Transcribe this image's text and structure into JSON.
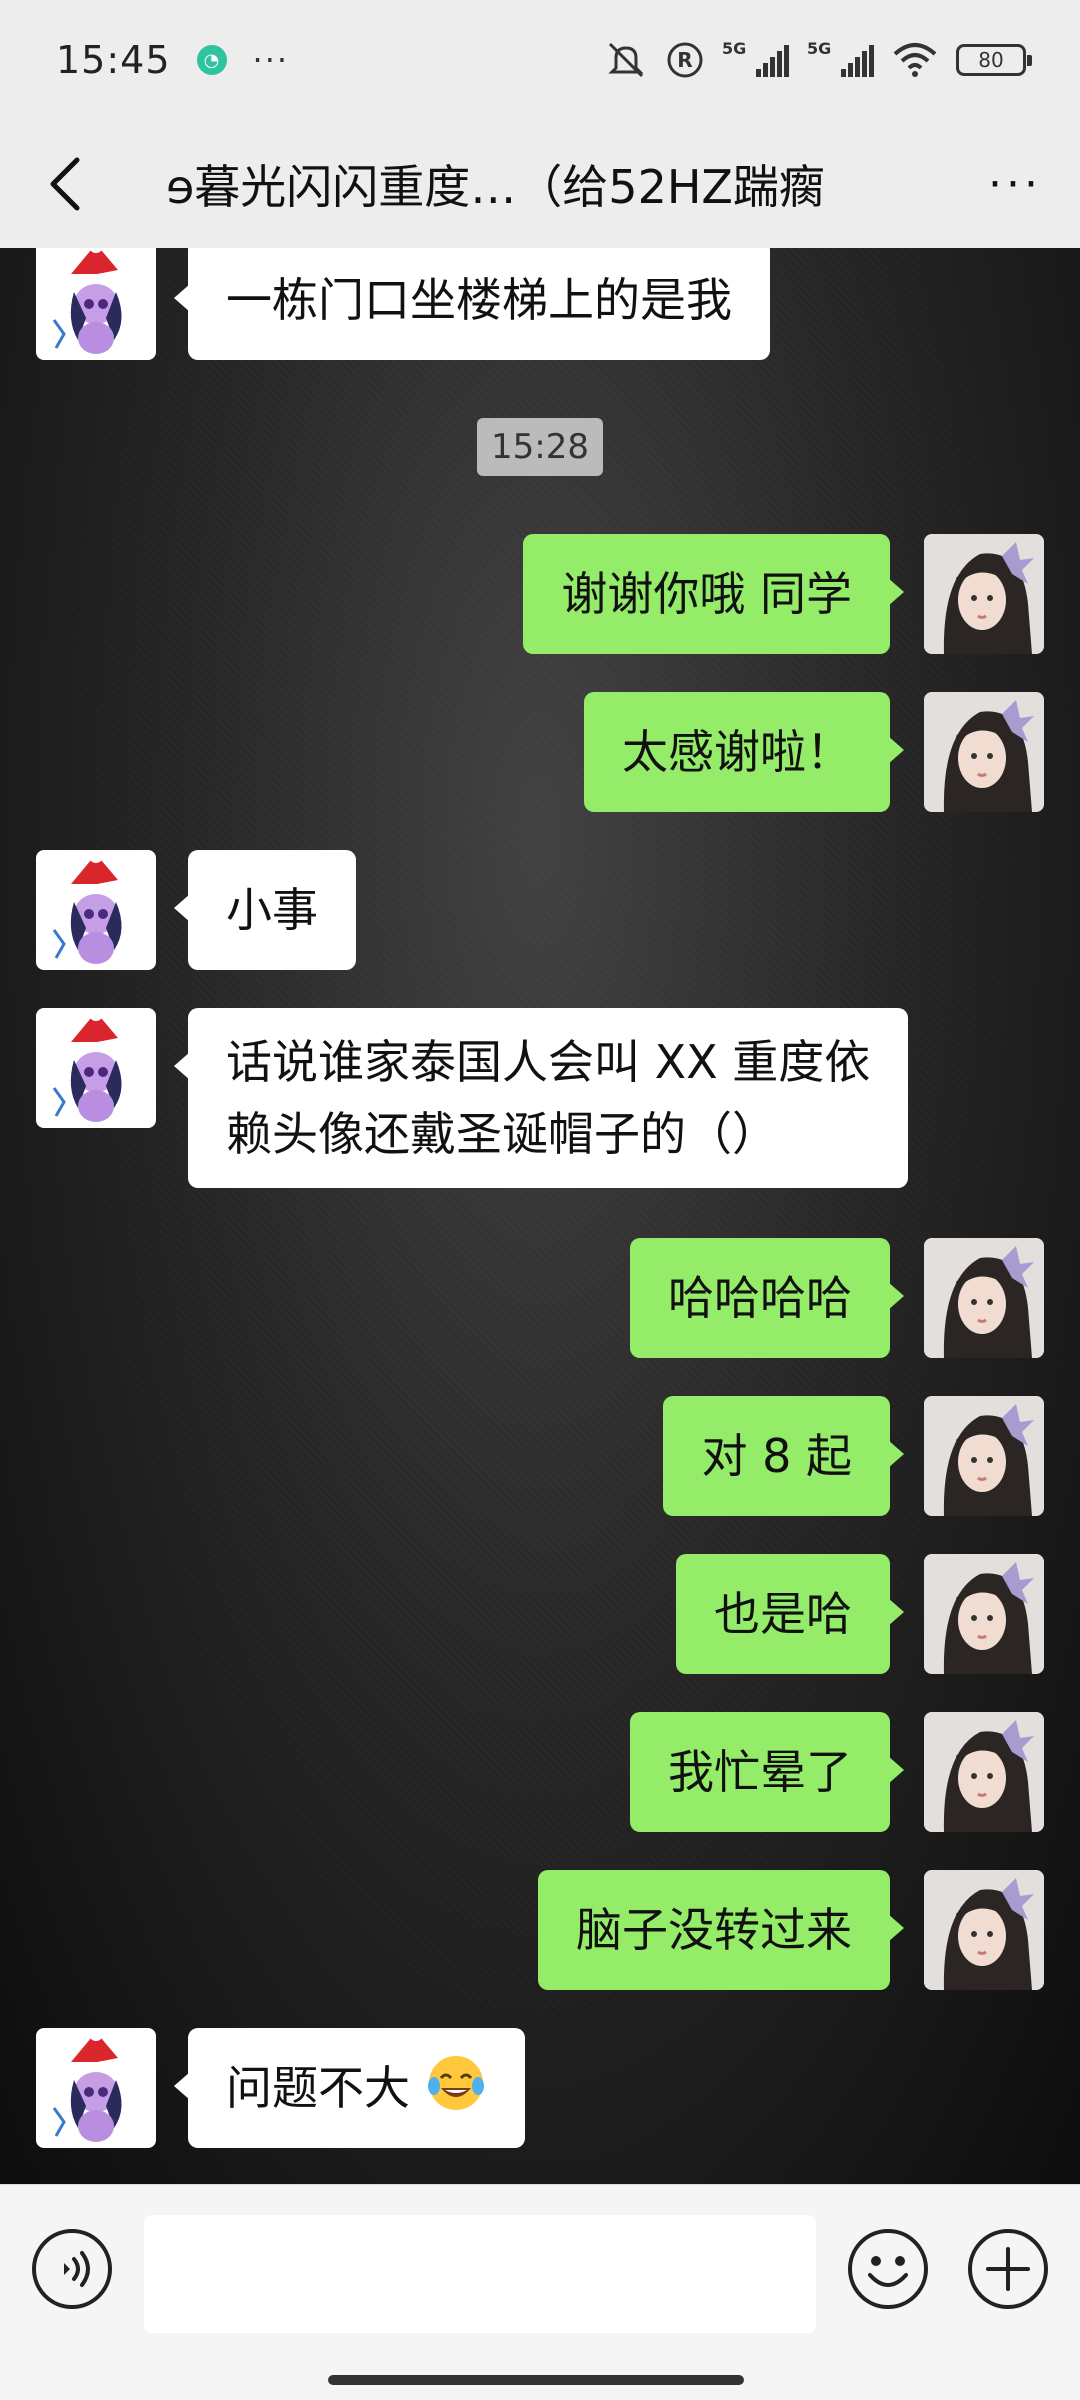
{
  "status_bar": {
    "time": "15:45",
    "more": "···",
    "network_1": "5G",
    "network_2": "5G",
    "battery": "80"
  },
  "header": {
    "title": "ɘ暮光闪闪重度…（给52HZ踹瘸",
    "more_label": "···"
  },
  "chat": {
    "timestamp": "15:28",
    "messages": [
      {
        "side": "left",
        "text": "一栋门口坐楼梯上的是我"
      },
      {
        "side": "right",
        "text": "谢谢你哦 同学"
      },
      {
        "side": "right",
        "text": "太感谢啦！"
      },
      {
        "side": "left",
        "text": "小事"
      },
      {
        "side": "left",
        "line1": "话说谁家泰国人会叫 XX 重度依",
        "line2": "赖头像还戴圣诞帽子的（）"
      },
      {
        "side": "right",
        "text": "哈哈哈哈"
      },
      {
        "side": "right",
        "text": "对 8 起"
      },
      {
        "side": "right",
        "text": "也是哈"
      },
      {
        "side": "right",
        "text": "我忙晕了"
      },
      {
        "side": "right",
        "text": "脑子没转过来"
      },
      {
        "side": "left",
        "text": "问题不大",
        "emoji": "tears-of-joy"
      }
    ]
  },
  "input_bar": {
    "value": "",
    "icons": [
      "voice-icon",
      "emoji-icon",
      "plus-icon"
    ]
  },
  "colors": {
    "self_bubble": "#95ec69",
    "other_bubble": "#ffffff",
    "bar_bg": "#ededed"
  }
}
